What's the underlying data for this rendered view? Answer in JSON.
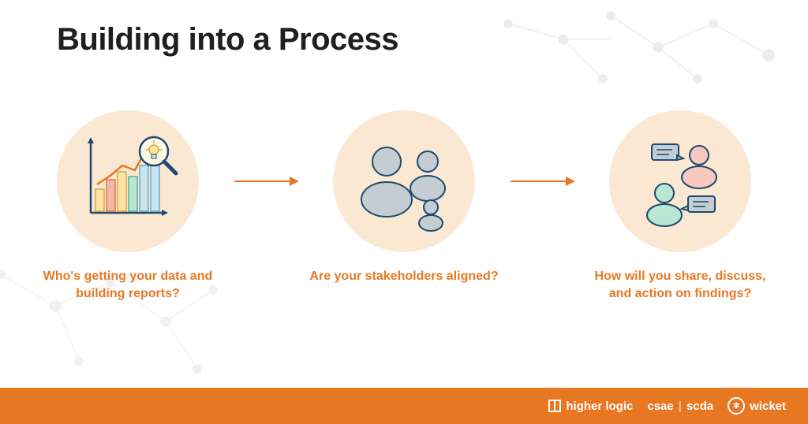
{
  "title": "Building into a Process",
  "steps": [
    {
      "icon": "chart-magnify-icon",
      "label": "Who's getting your data and building reports?"
    },
    {
      "icon": "people-group-icon",
      "label": "Are your stakeholders aligned?"
    },
    {
      "icon": "people-discuss-icon",
      "label": "How will you share, discuss, and action on findings?"
    }
  ],
  "footer": {
    "logos": [
      {
        "name": "higher logic"
      },
      {
        "name": "csae"
      },
      {
        "name": "scda"
      },
      {
        "name": "wicket"
      }
    ]
  },
  "colors": {
    "accent": "#e87722",
    "circle_bg": "#fbe8d2",
    "text_dark": "#1f1f1f"
  }
}
